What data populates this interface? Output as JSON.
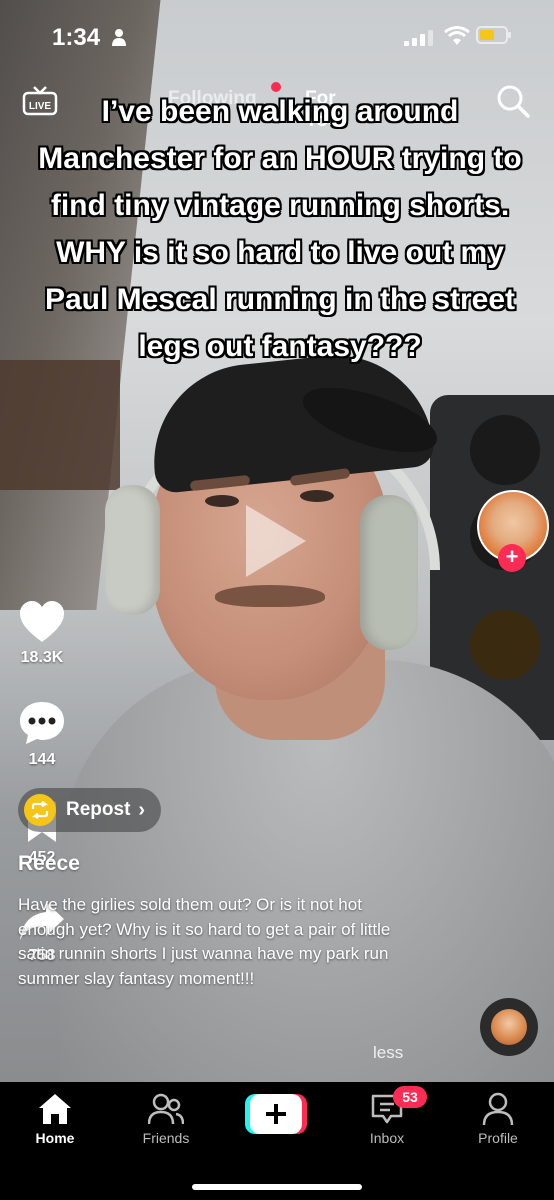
{
  "status_bar": {
    "time": "1:34"
  },
  "top_nav": {
    "live_label": "LIVE",
    "tab_following": "Following",
    "tab_for_you": "For You"
  },
  "caption": "I’ve been walking around Manchester for an HOUR trying to find tiny vintage running shorts. WHY is it so hard to live out my Paul Mescal running in the street legs out fantasy???",
  "rail": {
    "likes": "18.3K",
    "comments": "144",
    "bookmarks": "452",
    "shares": "758"
  },
  "repost": {
    "label": "Repost"
  },
  "post": {
    "username": "Reece",
    "description": "Have the girlies sold them out? Or is it not hot enough yet? Why is it so hard to get a pair of little satin runnin shorts I just wanna have my park run summer slay fantasy moment!!!",
    "less": "less"
  },
  "bottom_nav": {
    "home": "Home",
    "friends": "Friends",
    "inbox": "Inbox",
    "inbox_badge": "53",
    "profile": "Profile"
  },
  "colors": {
    "accent": "#fe2c55",
    "repost": "#f5c518",
    "create_cyan": "#25f4ee"
  }
}
